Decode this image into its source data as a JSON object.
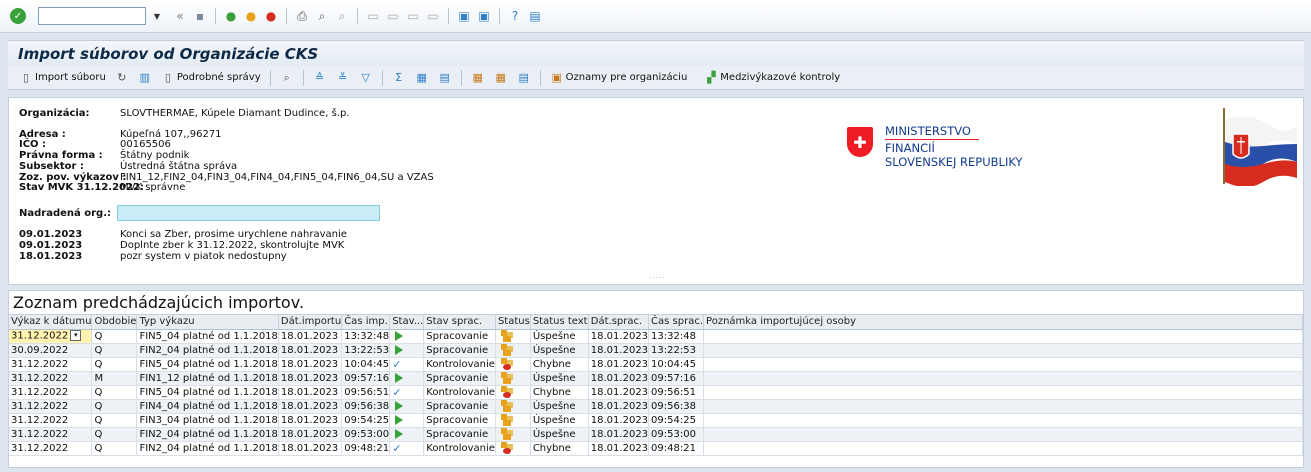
{
  "window": {
    "title": "Import súborov od Organizácie CKS"
  },
  "system_toolbar": {
    "command_value": ""
  },
  "app_toolbar": {
    "import_label": "Import súboru",
    "detail_label": "Podrobné správy",
    "notices_label": "Oznamy pre organizáciu",
    "cross_check_label": "Medzivýkazové kontroly"
  },
  "header": {
    "org_label": "Organizácia:",
    "org_value": "SLOVTHERMAE, Kúpele Diamant Dudince, š.p.",
    "address_label": "Adresa :",
    "address_value": "Kúpeľná 107,,96271",
    "ico_label": "IČO :",
    "ico_value": "00165506",
    "legal_label": "Právna forma :",
    "legal_value": "Štátny podnik",
    "subsector_label": "Subsektor :",
    "subsector_value": "Ústredná štátna správa",
    "reports_label": "Zoz. pov. výkazov :",
    "reports_value": "FIN1_12,FIN2_04,FIN3_04,FIN4_04,FIN5_04,FIN6_04,SU a VZAS",
    "mvk_label": "Stav MVK 31.12.2022:",
    "mvk_value": "MVK správne",
    "parent_label": "Nadradená org.:",
    "parent_value": "",
    "notices": [
      {
        "date": "09.01.2023",
        "text": "Konci sa Zber, prosime urychlene nahravanie"
      },
      {
        "date": "09.01.2023",
        "text": "Doplnte zber k 31.12.2022, skontrolujte MVK"
      },
      {
        "date": "18.01.2023",
        "text": "pozr system v piatok nedostupny"
      }
    ],
    "logo_line1": "MINISTERSTVO",
    "logo_line2": "FINANCIÍ",
    "logo_line3": "SLOVENSKEJ REPUBLIKY"
  },
  "list": {
    "title": "Zoznam predchádzajúcich importov.",
    "columns": [
      "Výkaz k dátumu",
      "Obdobie",
      "Typ výkazu",
      "Dát.importu",
      "Čas imp.",
      "Stav...",
      "Stav sprac.",
      "Status",
      "Status text",
      "Dát.sprac.",
      "Čas sprac.",
      "Poznámka importujúcej osoby"
    ],
    "rows": [
      {
        "date": "31.12.2022",
        "period": "Q",
        "type": "FIN5_04 platné od 1.1.2018",
        "import_date": "18.01.2023",
        "import_time": "13:32:48",
        "state_icon": "play",
        "state": "Spracovanie",
        "status_icon": "ok",
        "status_text": "Úspešne",
        "proc_date": "18.01.2023",
        "proc_time": "13:32:48",
        "note": ""
      },
      {
        "date": "30.09.2022",
        "period": "Q",
        "type": "FIN2_04 platné od 1.1.2018",
        "import_date": "18.01.2023",
        "import_time": "13:22:53",
        "state_icon": "play",
        "state": "Spracovanie",
        "status_icon": "ok",
        "status_text": "Úspešne",
        "proc_date": "18.01.2023",
        "proc_time": "13:22:53",
        "note": ""
      },
      {
        "date": "31.12.2022",
        "period": "Q",
        "type": "FIN5_04 platné od 1.1.2018",
        "import_date": "18.01.2023",
        "import_time": "10:04:45",
        "state_icon": "check",
        "state": "Kontrolovanie",
        "status_icon": "err",
        "status_text": "Chybne",
        "proc_date": "18.01.2023",
        "proc_time": "10:04:45",
        "note": ""
      },
      {
        "date": "31.12.2022",
        "period": "M",
        "type": "FIN1_12 platné od 1.1.2018",
        "import_date": "18.01.2023",
        "import_time": "09:57:16",
        "state_icon": "play",
        "state": "Spracovanie",
        "status_icon": "ok",
        "status_text": "Úspešne",
        "proc_date": "18.01.2023",
        "proc_time": "09:57:16",
        "note": ""
      },
      {
        "date": "31.12.2022",
        "period": "Q",
        "type": "FIN5_04 platné od 1.1.2018",
        "import_date": "18.01.2023",
        "import_time": "09:56:51",
        "state_icon": "check",
        "state": "Kontrolovanie",
        "status_icon": "err",
        "status_text": "Chybne",
        "proc_date": "18.01.2023",
        "proc_time": "09:56:51",
        "note": ""
      },
      {
        "date": "31.12.2022",
        "period": "Q",
        "type": "FIN4_04 platné od 1.1.2018",
        "import_date": "18.01.2023",
        "import_time": "09:56:38",
        "state_icon": "play",
        "state": "Spracovanie",
        "status_icon": "ok",
        "status_text": "Úspešne",
        "proc_date": "18.01.2023",
        "proc_time": "09:56:38",
        "note": ""
      },
      {
        "date": "31.12.2022",
        "period": "Q",
        "type": "FIN3_04 platné od 1.1.2018",
        "import_date": "18.01.2023",
        "import_time": "09:54:25",
        "state_icon": "play",
        "state": "Spracovanie",
        "status_icon": "ok",
        "status_text": "Úspešne",
        "proc_date": "18.01.2023",
        "proc_time": "09:54:25",
        "note": ""
      },
      {
        "date": "31.12.2022",
        "period": "Q",
        "type": "FIN2_04 platné od 1.1.2018",
        "import_date": "18.01.2023",
        "import_time": "09:53:00",
        "state_icon": "play",
        "state": "Spracovanie",
        "status_icon": "ok",
        "status_text": "Úspešne",
        "proc_date": "18.01.2023",
        "proc_time": "09:53:00",
        "note": ""
      },
      {
        "date": "31.12.2022",
        "period": "Q",
        "type": "FIN2_04 platné od 1.1.2018",
        "import_date": "18.01.2023",
        "import_time": "09:48:21",
        "state_icon": "check",
        "state": "Kontrolovanie",
        "status_icon": "err",
        "status_text": "Chybne",
        "proc_date": "18.01.2023",
        "proc_time": "09:48:21",
        "note": ""
      }
    ]
  },
  "colors": {
    "accent": "#0e2a46",
    "ok": "#3aa13a",
    "error": "#d62b1f",
    "selected_cell": "#fff3b0"
  }
}
